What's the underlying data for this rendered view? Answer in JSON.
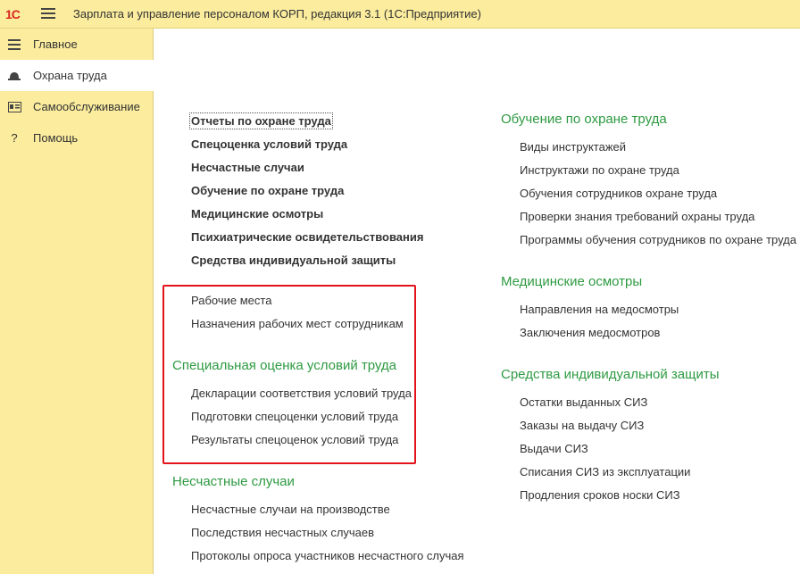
{
  "app": {
    "logo": "1С",
    "title": "Зарплата и управление персоналом КОРП, редакция 3.1  (1С:Предприятие)"
  },
  "sidebar": {
    "items": [
      {
        "label": "Главное",
        "icon": "menu-lines-icon"
      },
      {
        "label": "Охрана труда",
        "icon": "hard-hat-icon",
        "active": true
      },
      {
        "label": "Самообслуживание",
        "icon": "id-card-icon"
      },
      {
        "label": "Помощь",
        "icon": "question-icon"
      }
    ]
  },
  "left_column": {
    "bold_links": [
      "Отчеты по охране труда",
      "Спецоценка условий труда",
      "Несчастные случаи",
      "Обучение по охране труда",
      "Медицинские осмотры",
      "Психиатрические освидетельствования",
      "Средства индивидуальной защиты"
    ],
    "workplace_links": [
      "Рабочие места",
      "Назначения рабочих мест сотрудникам"
    ],
    "special_assessment": {
      "title": "Специальная оценка условий труда",
      "links": [
        "Декларации соответствия условий труда",
        "Подготовки спецоценки условий труда",
        "Результаты спецоценок условий труда"
      ]
    },
    "accidents": {
      "title": "Несчастные случаи",
      "links": [
        "Несчастные случаи на производстве",
        "Последствия несчастных случаев",
        "Протоколы опроса участников несчастного случая"
      ]
    }
  },
  "right_column": {
    "training": {
      "title": "Обучение по охране труда",
      "links": [
        "Виды инструктажей",
        "Инструктажи по охране труда",
        "Обучения сотрудников охране труда",
        "Проверки знания требований охраны труда",
        "Программы обучения сотрудников по охране труда"
      ]
    },
    "medical": {
      "title": "Медицинские осмотры",
      "links": [
        "Направления на медосмотры",
        "Заключения медосмотров"
      ]
    },
    "ppe": {
      "title": "Средства индивидуальной защиты",
      "links": [
        "Остатки выданных СИЗ",
        "Заказы на выдачу СИЗ",
        "Выдачи СИЗ",
        "Списания СИЗ из эксплуатации",
        "Продления сроков носки СИЗ"
      ]
    }
  },
  "colors": {
    "panel_bg": "#fbec9e",
    "section_title": "#2e9a42",
    "highlight_border": "#e3131b"
  }
}
